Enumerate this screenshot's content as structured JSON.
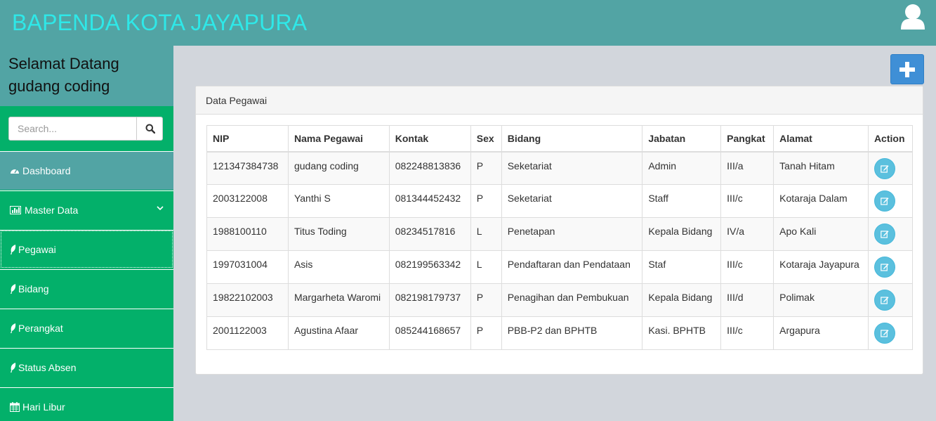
{
  "header": {
    "brand": "BAPENDA KOTA JAYAPURA",
    "user_icon": "user-icon"
  },
  "sidebar": {
    "welcome_line1": "Selamat Datang",
    "welcome_line2": "gudang coding",
    "search_placeholder": "Search...",
    "items": [
      {
        "label": "Dashboard",
        "icon": "dashboard-icon"
      },
      {
        "label": "Master Data",
        "icon": "bar-chart-icon"
      },
      {
        "label": "Pegawai",
        "icon": "leaf-icon"
      },
      {
        "label": "Bidang",
        "icon": "leaf-icon"
      },
      {
        "label": "Perangkat",
        "icon": "leaf-icon"
      },
      {
        "label": "Status Absen",
        "icon": "leaf-icon"
      },
      {
        "label": "Hari Libur",
        "icon": "calendar-icon"
      }
    ]
  },
  "main": {
    "add_icon": "plus-icon",
    "panel_title": "Data Pegawai",
    "columns": [
      "NIP",
      "Nama Pegawai",
      "Kontak",
      "Sex",
      "Bidang",
      "Jabatan",
      "Pangkat",
      "Alamat",
      "Action"
    ],
    "rows": [
      [
        "121347384738",
        "gudang coding",
        "082248813836",
        "P",
        "Seketariat",
        "Admin",
        "III/a",
        "Tanah Hitam"
      ],
      [
        "2003122008",
        "Yanthi S",
        "081344452432",
        "P",
        "Seketariat",
        "Staff",
        "III/c",
        "Kotaraja Dalam"
      ],
      [
        "1988100110",
        "Titus Toding",
        "08234517816",
        "L",
        "Penetapan",
        "Kepala Bidang",
        "IV/a",
        "Apo Kali"
      ],
      [
        "1997031004",
        "Asis",
        "082199563342",
        "L",
        "Pendaftaran dan Pendataan",
        "Staf",
        "III/c",
        "Kotaraja Jayapura"
      ],
      [
        "19822102003",
        "Margarheta Waromi",
        "082198179737",
        "P",
        "Penagihan dan Pembukuan",
        "Kepala Bidang",
        "III/d",
        "Polimak"
      ],
      [
        "2001122003",
        "Agustina Afaar",
        "085244168657",
        "P",
        "PBB-P2 dan BPHTB",
        "Kasi. BPHTB",
        "III/c",
        "Argapura"
      ]
    ]
  },
  "colors": {
    "header": "#52a4a4",
    "brand_text": "#2ee8e8",
    "sidebar": "#03b06a",
    "add_button": "#3f8fd6",
    "edit_button": "#5bc0de"
  }
}
